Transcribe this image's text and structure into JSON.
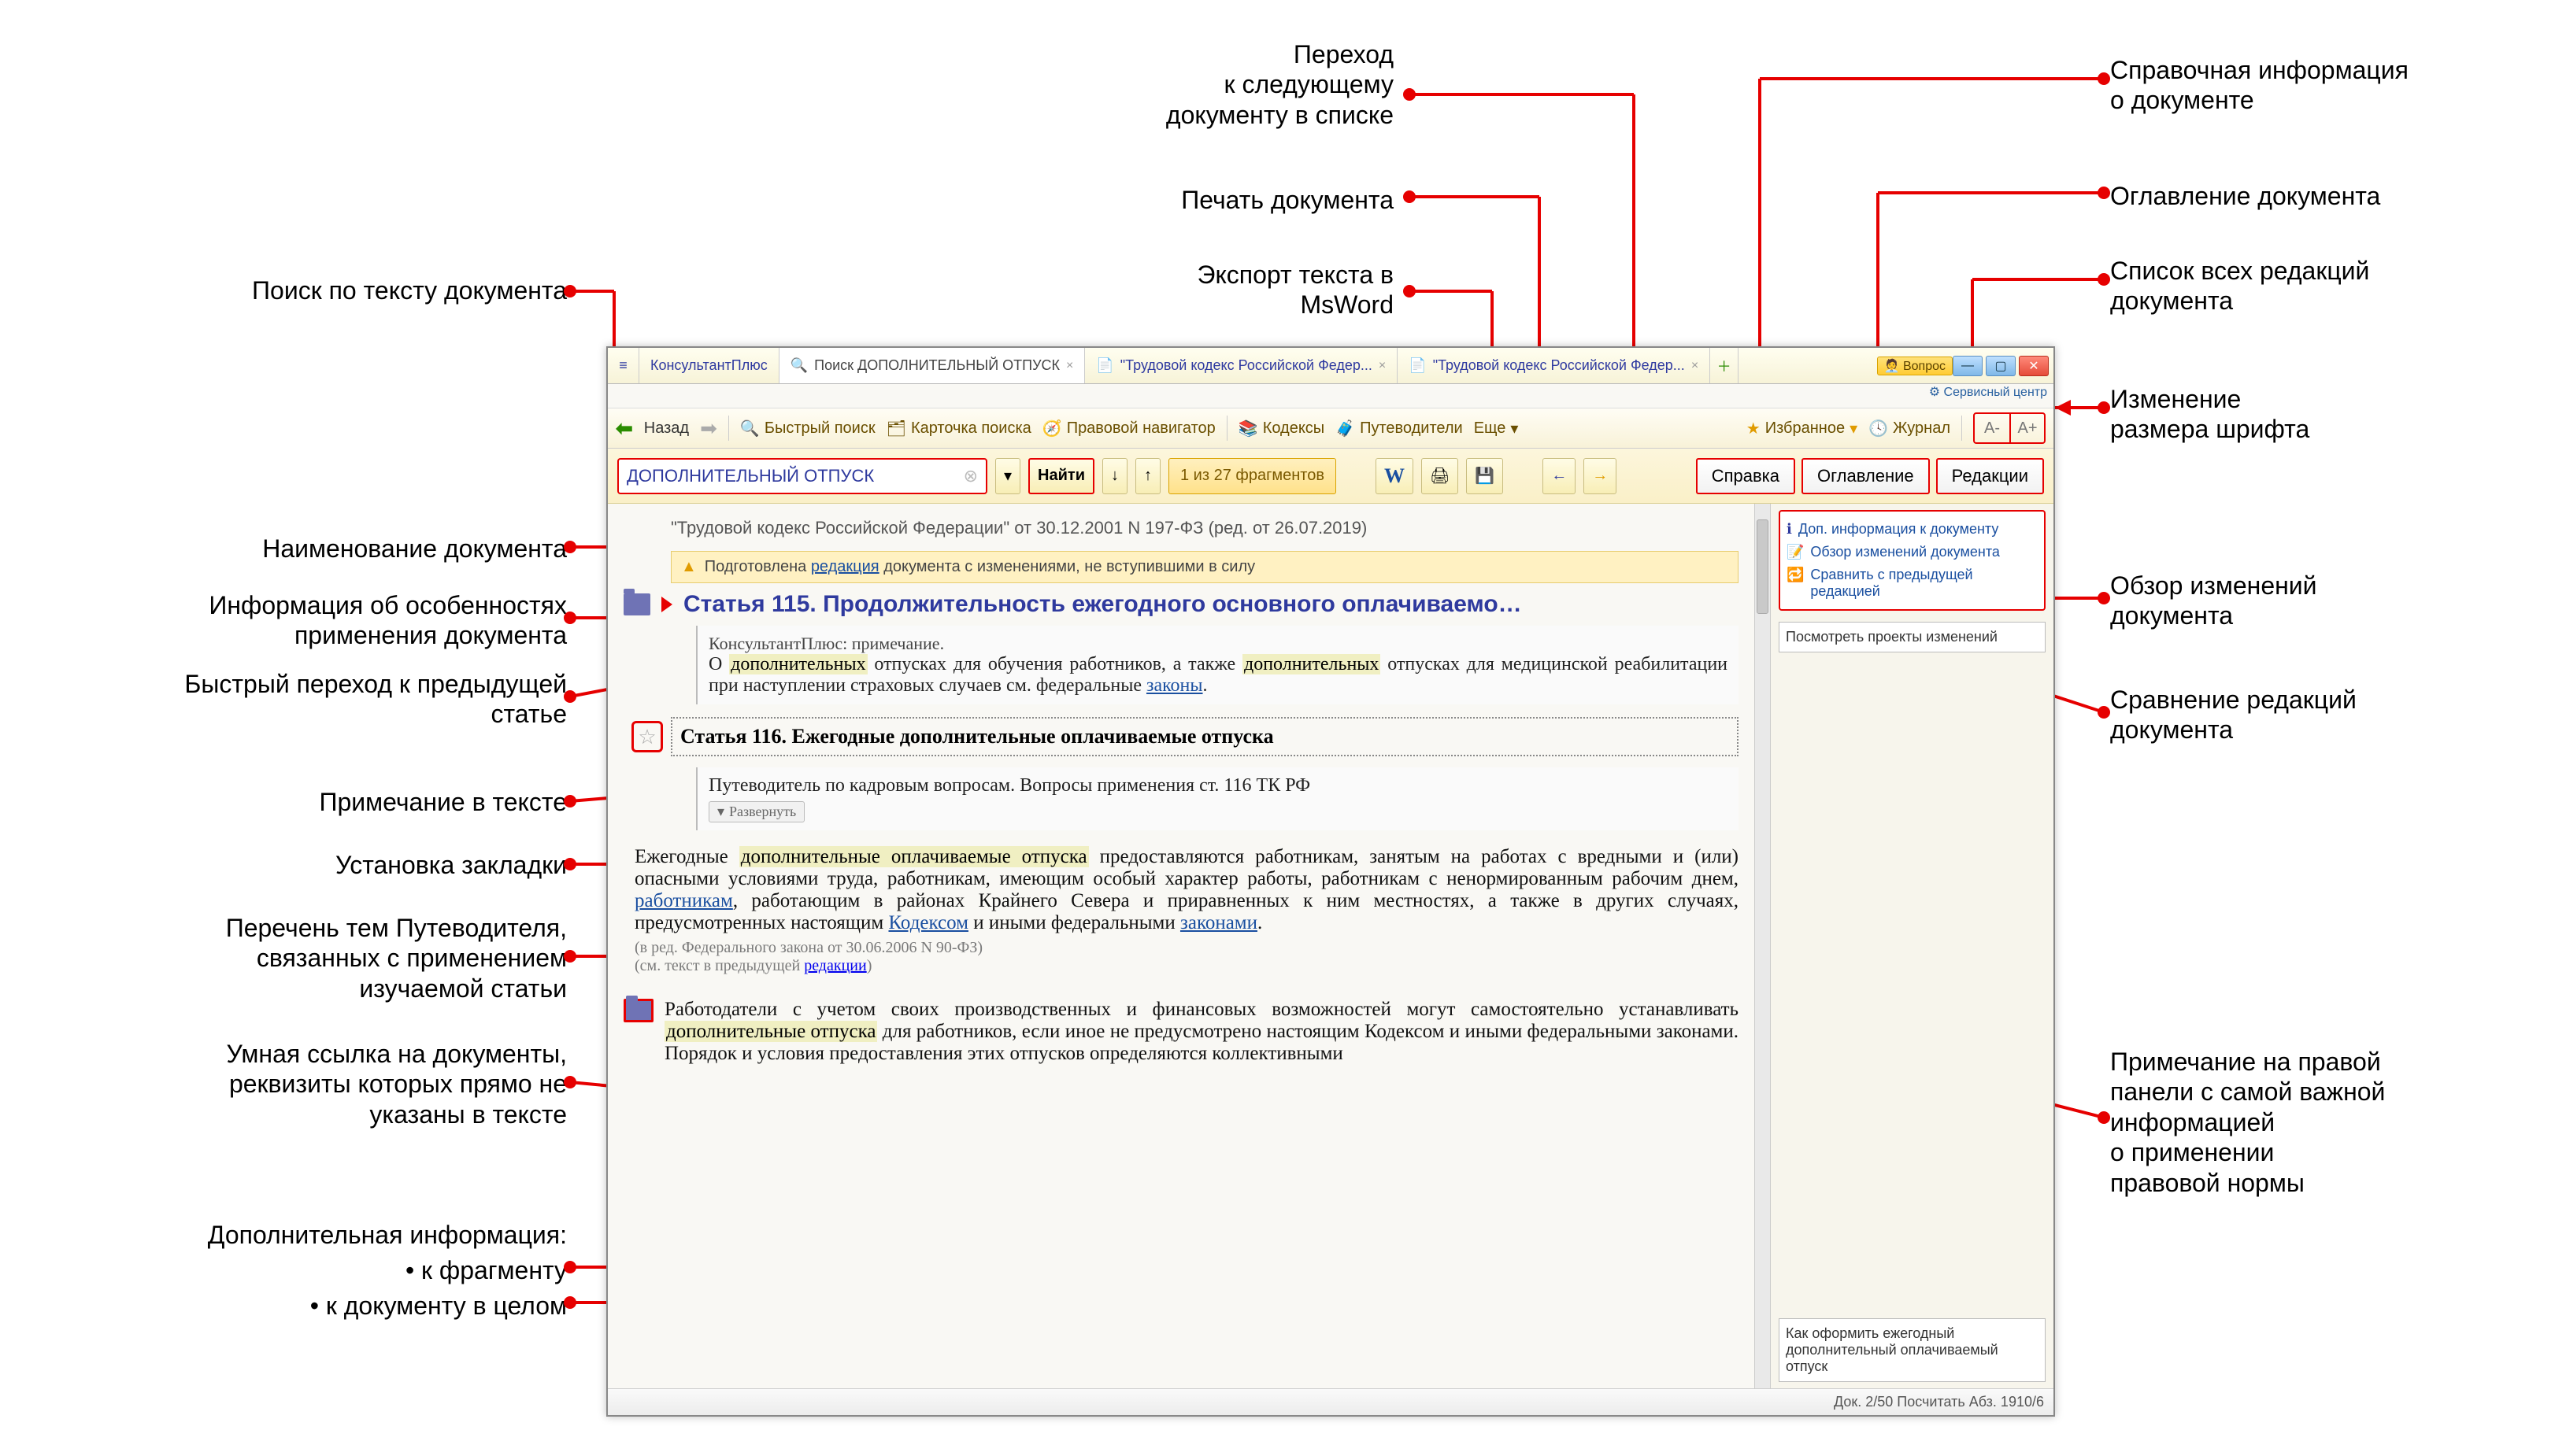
{
  "annotations": {
    "search_doc_text": "Поиск по тексту документа",
    "doc_name": "Наименование документа",
    "app_info": "Информация об особенностях\nприменения документа",
    "prev_article": "Быстрый переход к предыдущей\nстатье",
    "text_note": "Примечание в тексте",
    "set_bookmark": "Установка закладки",
    "guide_topics": "Перечень тем Путеводителя,\nсвязанных с применением\nизучаемой статьи",
    "smart_link": "Умная ссылка на документы,\nреквизиты которых прямо не\nуказаны в тексте",
    "extra_info": "Дополнительная информация:",
    "extra_info_a": "• к фрагменту",
    "extra_info_b": "• к документу в целом",
    "next_doc": "Переход\nк следующему\nдокументу в списке",
    "print_doc": "Печать документа",
    "export_word": "Экспорт текста в\nMsWord",
    "ref_info": "Справочная информация\nо документе",
    "toc": "Оглавление документа",
    "editions": "Список всех редакций\nдокумента",
    "font_size": "Изменение\nразмера шрифта",
    "changes_review": "Обзор изменений\nдокумента",
    "compare_editions": "Сравнение редакций\nдокумента",
    "right_note": "Примечание на правой\nпанели с самой важной\nинформацией\nо применении\nправовой нормы"
  },
  "window": {
    "app_tab": "КонсультантПлюс",
    "tab2": "Поиск ДОПОЛНИТЕЛЬНЫЙ ОТПУСК",
    "tab3": "\"Трудовой кодекс Российской Федер...",
    "tab4": "\"Трудовой кодекс Российской Федер...",
    "question_btn": "Вопрос",
    "service_center": "Сервисный центр"
  },
  "toolbar": {
    "back": "Назад",
    "quick_search": "Быстрый поиск",
    "search_card": "Карточка поиска",
    "legal_nav": "Правовой навигатор",
    "kodeks": "Кодексы",
    "guides": "Путеводители",
    "more": "Еще",
    "favorites": "Избранное",
    "journal": "Журнал",
    "font_minus": "A-",
    "font_plus": "A+"
  },
  "searchrow": {
    "query": "ДОПОЛНИТЕЛЬНЫЙ ОТПУСК",
    "find": "Найти",
    "frag": "1 из 27 фрагментов",
    "btn_ref": "Справка",
    "btn_toc": "Оглавление",
    "btn_ed": "Редакции"
  },
  "doc": {
    "title": "\"Трудовой кодекс Российской Федерации\" от 30.12.2001 N 197-ФЗ (ред. от 26.07.2019)",
    "warn_pre": "Подготовлена",
    "warn_link": "редакция",
    "warn_post": "документа с изменениями, не вступившими в силу",
    "art115_hdr": "Статья 115. Продолжительность ежегодного основного оплачиваемо…",
    "note_title": "КонсультантПлюс: примечание.",
    "note_body_1": "О ",
    "note_body_2": " отпусках для обучения работников, а также ",
    "note_body_3": " отпусках для медицинской реабилитации при наступлении страховых случаев см. федеральные ",
    "note_link": "законы",
    "art116_hdr": "Статья 116. Ежегодные дополнительные оплачиваемые отпуска",
    "guide_title": "Путеводитель по кадровым вопросам. Вопросы применения ст. 116 ТК РФ",
    "expand": "Развернуть",
    "p1_a": "Ежегодные ",
    "p1_b": " предоставляются работникам, занятым на работах с вредными и (или) опасными условиями труда, работникам, имеющим особый характер работы, работникам с ненормированным рабочим днем, ",
    "p1_link1": "работникам",
    "p1_c": ", работающим в районах Крайнего Севера и приравненных к ним местностях, а также в других случаях, предусмотренных настоящим ",
    "p1_link2": "Кодексом",
    "p1_d": " и иными федеральными ",
    "p1_link3": "законами",
    "p1_e": ".",
    "hl1": "дополнительных",
    "hl2": "дополнительных",
    "hl3": "дополнительные оплачиваемые отпуска",
    "ed_note1": "(в ред. Федерального закона от 30.06.2006 N 90-ФЗ)",
    "ed_note2_a": "(см. текст в предыдущей ",
    "ed_note2_link": "редакции",
    "ed_note2_b": ")",
    "p2": "Работодатели с учетом своих производственных и финансовых возможностей могут самостоятельно устанавливать ",
    "p2_hl": "дополнительные отпуска",
    "p2_b": " для работников, если иное не предусмотрено настоящим Кодексом и иными федеральными законами. Порядок и условия предоставления этих отпусков определяются коллективными"
  },
  "rpanel": {
    "i1": "Доп. информация к документу",
    "i2": "Обзор изменений документа",
    "i3": "Сравнить с предыдущей редакцией",
    "box2": "Посмотреть проекты изменений",
    "box3": "Как оформить ежегодный дополнительный оплачиваемый отпуск"
  },
  "status": {
    "text": "Док. 2/50 Посчитать Абз. 1910/6"
  }
}
